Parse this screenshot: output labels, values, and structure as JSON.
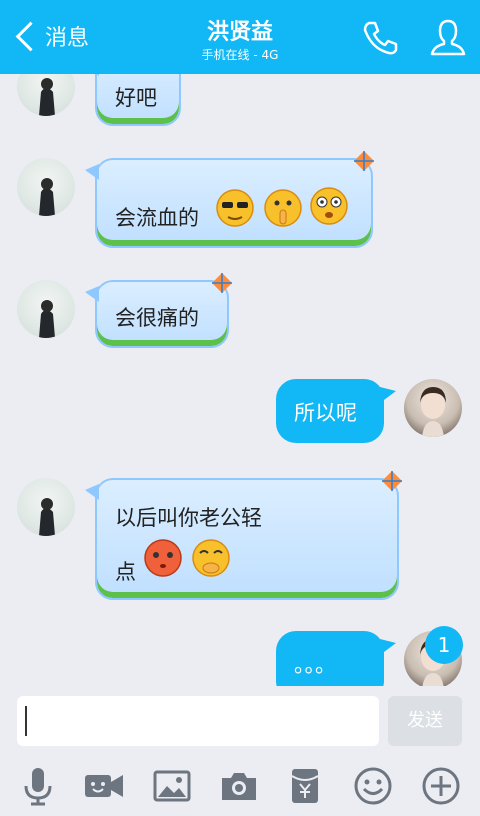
{
  "header": {
    "back_label": "消息",
    "title": "洪贤益",
    "subtitle": "手机在线 - 4G"
  },
  "messages": [
    {
      "side": "left",
      "text": "好吧"
    },
    {
      "side": "left",
      "text": "会流血的",
      "emojis": [
        "cool-face",
        "shush-face",
        "scared-face"
      ]
    },
    {
      "side": "left",
      "text": "会很痛的"
    },
    {
      "side": "right",
      "text": "所以呢"
    },
    {
      "side": "left",
      "text": "以后叫你老公轻",
      "text2": "点",
      "emojis": [
        "flushed-face",
        "giggle-face"
      ]
    },
    {
      "side": "right",
      "text": "。。。"
    }
  ],
  "unread_badge": "1",
  "composer": {
    "send_label": "发送"
  },
  "colors": {
    "accent": "#12b7f5",
    "background": "#ebedf2",
    "bubble_left": "#cfe6ff",
    "bubble_right": "#12b7f5"
  },
  "toolbar_icons": [
    "microphone-icon",
    "video-call-icon",
    "image-icon",
    "camera-icon",
    "red-packet-icon",
    "emoji-icon",
    "plus-icon"
  ]
}
